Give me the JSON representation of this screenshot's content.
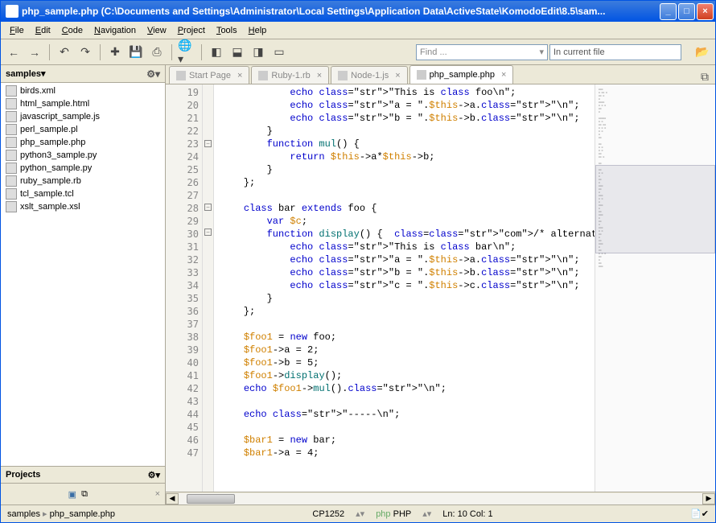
{
  "window": {
    "title": "php_sample.php (C:\\Documents and Settings\\Administrator\\Local Settings\\Application Data\\ActiveState\\KomodoEdit\\8.5\\sam..."
  },
  "menu": [
    "File",
    "Edit",
    "Code",
    "Navigation",
    "View",
    "Project",
    "Tools",
    "Help"
  ],
  "toolbar": {
    "find_placeholder": "Find ...",
    "find_dropdown": "▾",
    "scope": "In current file"
  },
  "sidebar": {
    "panel_title": "samples",
    "panel_dropdown": "▾",
    "files": [
      "birds.xml",
      "html_sample.html",
      "javascript_sample.js",
      "perl_sample.pl",
      "php_sample.php",
      "python3_sample.py",
      "python_sample.py",
      "ruby_sample.rb",
      "tcl_sample.tcl",
      "xslt_sample.xsl"
    ],
    "projects_title": "Projects",
    "close_x": "×"
  },
  "tabs": [
    {
      "label": "Start Page",
      "active": false
    },
    {
      "label": "Ruby-1.rb",
      "active": false
    },
    {
      "label": "Node-1.js",
      "active": false
    },
    {
      "label": "php_sample.php",
      "active": true
    }
  ],
  "editor": {
    "line_start": 19,
    "line_end": 47,
    "fold_lines": [
      23,
      28,
      30
    ],
    "lines": [
      {
        "n": 19,
        "t": "            echo \"This is class foo\\n\";",
        "cls": [
          "echo:kw",
          "\"This is class foo\\n\":str"
        ]
      },
      {
        "n": 20,
        "t": "            echo \"a = \".$this->a.\"\\n\";"
      },
      {
        "n": 21,
        "t": "            echo \"b = \".$this->b.\"\\n\";"
      },
      {
        "n": 22,
        "t": "        }"
      },
      {
        "n": 23,
        "t": "        function mul() {"
      },
      {
        "n": 24,
        "t": "            return $this->a*$this->b;"
      },
      {
        "n": 25,
        "t": "        }"
      },
      {
        "n": 26,
        "t": "    };"
      },
      {
        "n": 27,
        "t": ""
      },
      {
        "n": 28,
        "t": "    class bar extends foo {"
      },
      {
        "n": 29,
        "t": "        var $c;"
      },
      {
        "n": 30,
        "t": "        function display() {  /* alternative display function"
      },
      {
        "n": 31,
        "t": "            echo \"This is class bar\\n\";"
      },
      {
        "n": 32,
        "t": "            echo \"a = \".$this->a.\"\\n\";"
      },
      {
        "n": 33,
        "t": "            echo \"b = \".$this->b.\"\\n\";"
      },
      {
        "n": 34,
        "t": "            echo \"c = \".$this->c.\"\\n\";"
      },
      {
        "n": 35,
        "t": "        }"
      },
      {
        "n": 36,
        "t": "    };"
      },
      {
        "n": 37,
        "t": ""
      },
      {
        "n": 38,
        "t": "    $foo1 = new foo;"
      },
      {
        "n": 39,
        "t": "    $foo1->a = 2;"
      },
      {
        "n": 40,
        "t": "    $foo1->b = 5;"
      },
      {
        "n": 41,
        "t": "    $foo1->display();"
      },
      {
        "n": 42,
        "t": "    echo $foo1->mul().\"\\n\";"
      },
      {
        "n": 43,
        "t": ""
      },
      {
        "n": 44,
        "t": "    echo \"-----\\n\";"
      },
      {
        "n": 45,
        "t": ""
      },
      {
        "n": 46,
        "t": "    $bar1 = new bar;"
      },
      {
        "n": 47,
        "t": "    $bar1->a = 4;"
      }
    ]
  },
  "status": {
    "breadcrumb1": "samples",
    "breadcrumb2": "php_sample.php",
    "encoding": "CP1252",
    "language": "PHP",
    "php_prefix": "php",
    "position": "Ln: 10 Col: 1"
  }
}
